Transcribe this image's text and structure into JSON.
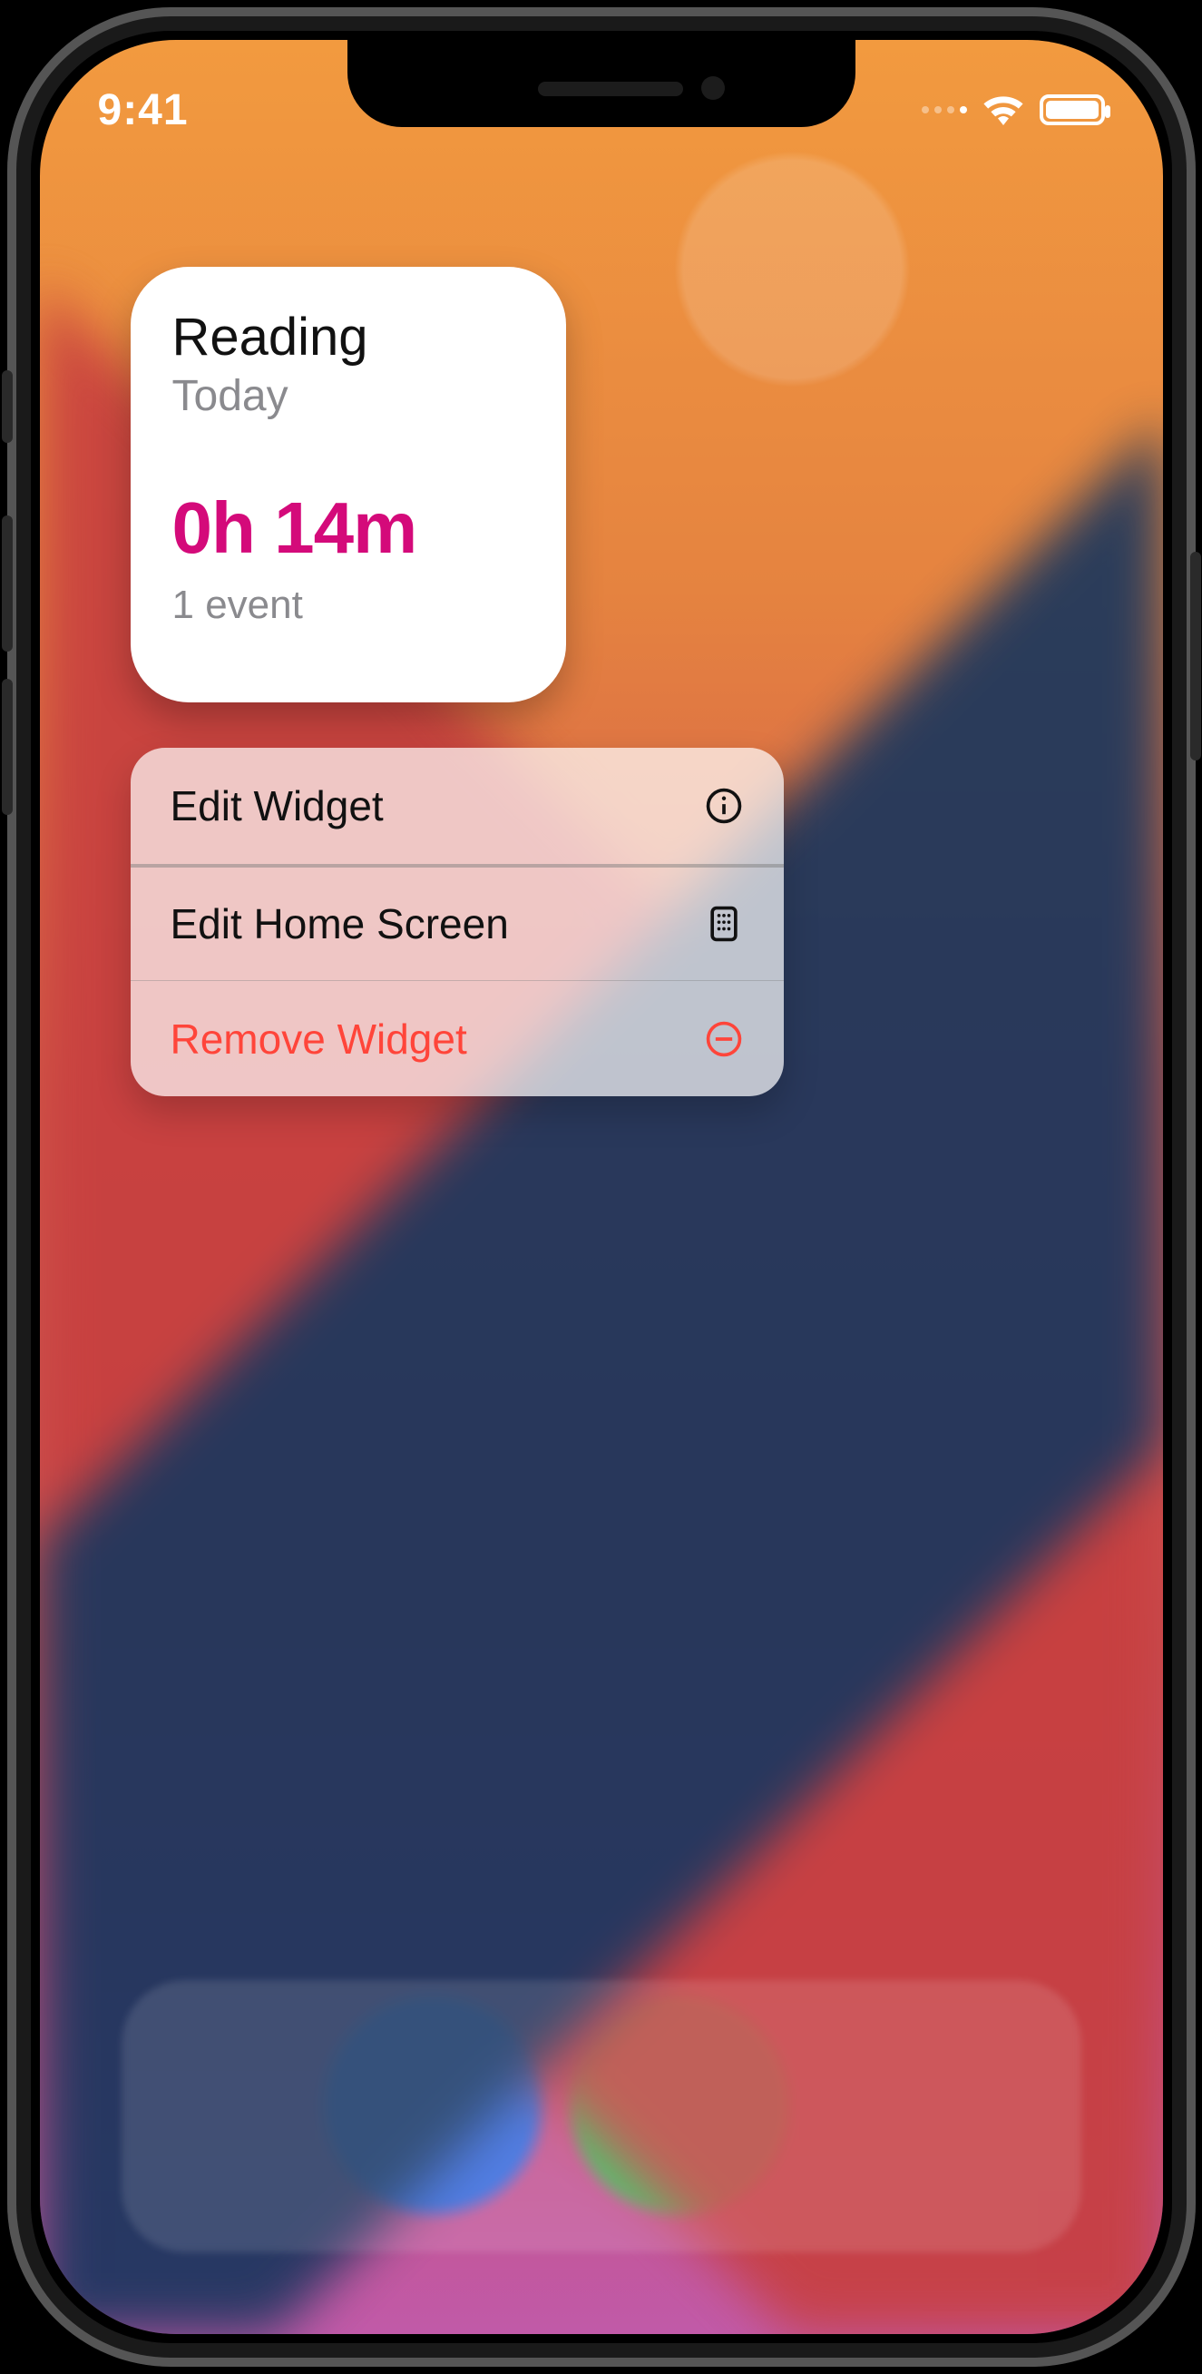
{
  "status": {
    "time": "9:41"
  },
  "widget": {
    "title": "Reading",
    "subtitle": "Today",
    "value": "0h 14m",
    "meta": "1 event"
  },
  "menu": {
    "items": [
      {
        "label": "Edit Widget",
        "icon": "info-circle-icon",
        "danger": false
      },
      {
        "label": "Edit Home Screen",
        "icon": "apps-grid-icon",
        "danger": false
      },
      {
        "label": "Remove Widget",
        "icon": "minus-circle-icon",
        "danger": true
      }
    ]
  }
}
